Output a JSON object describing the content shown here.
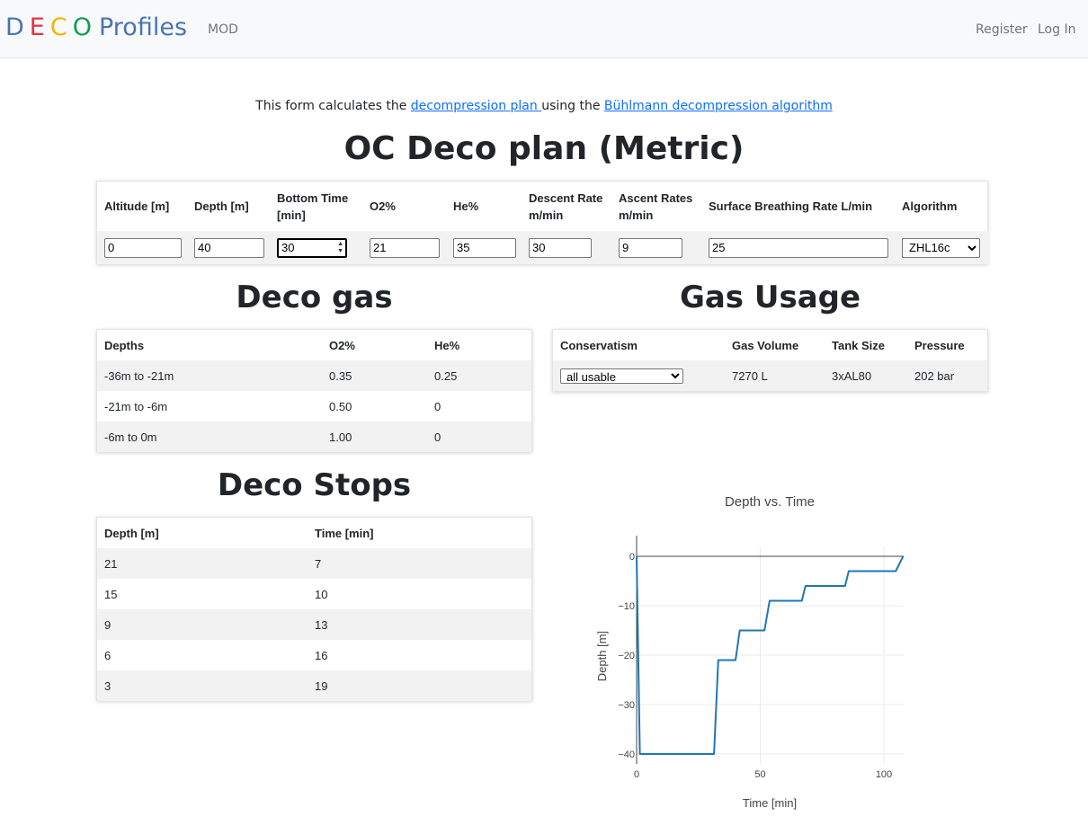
{
  "nav": {
    "brand_letters": [
      {
        "text": "D",
        "color": "#4a73b5"
      },
      {
        "text": "E",
        "color": "#e8313f"
      },
      {
        "text": "C",
        "color": "#f4b400"
      },
      {
        "text": "O",
        "color": "#0f9d58"
      }
    ],
    "brand_word": "Profiles",
    "mod_link": "MOD",
    "register": "Register",
    "login": "Log In"
  },
  "intro": {
    "prefix": "This form calculates the ",
    "link1": "decompression plan ",
    "middle": "using the ",
    "link2": "Bühlmann decompression algorithm"
  },
  "title": "OC Deco plan (Metric)",
  "plan": {
    "headers": {
      "altitude": "Altitude [m]",
      "depth": "Depth [m]",
      "bottom_time_1": "Bottom Time",
      "bottom_time_2": "[min]",
      "o2": "O2%",
      "he": "He%",
      "descent_1": "Descent Rate",
      "descent_2": "m/min",
      "ascent_1": "Ascent Rates",
      "ascent_2": "m/min",
      "sbr": "Surface Breathing Rate L/min",
      "algorithm": "Algorithm"
    },
    "values": {
      "altitude": "0",
      "depth": "40",
      "bottom_time": "30",
      "o2": "21",
      "he": "35",
      "descent": "30",
      "ascent": "9",
      "sbr": "25",
      "algorithm": "ZHL16c"
    }
  },
  "deco_gas": {
    "title": "Deco gas",
    "headers": {
      "depths": "Depths",
      "o2": "O2%",
      "he": "He%"
    },
    "rows": [
      {
        "depths": "-36m to -21m",
        "o2": "0.35",
        "he": "0.25"
      },
      {
        "depths": "-21m to -6m",
        "o2": "0.50",
        "he": "0"
      },
      {
        "depths": "-6m to 0m",
        "o2": "1.00",
        "he": "0"
      }
    ]
  },
  "gas_usage": {
    "title": "Gas Usage",
    "headers": {
      "conservatism": "Conservatism",
      "volume": "Gas Volume",
      "tank": "Tank Size",
      "pressure": "Pressure"
    },
    "row": {
      "conservatism": "all usable",
      "volume": "7270 L",
      "tank": "3xAL80",
      "pressure": "202 bar"
    }
  },
  "deco_stops": {
    "title": "Deco Stops",
    "headers": {
      "depth": "Depth [m]",
      "time": "Time [min]"
    },
    "rows": [
      {
        "depth": "21",
        "time": "7"
      },
      {
        "depth": "15",
        "time": "10"
      },
      {
        "depth": "9",
        "time": "13"
      },
      {
        "depth": "6",
        "time": "16"
      },
      {
        "depth": "3",
        "time": "19"
      }
    ]
  },
  "chart_data": {
    "type": "line",
    "title": "Depth vs. Time",
    "xlabel": "Time [min]",
    "ylabel": "Depth [m]",
    "xlim": [
      0,
      108
    ],
    "ylim": [
      -42,
      2
    ],
    "xticks": [
      "0",
      "50",
      "100"
    ],
    "xtick_values": [
      0,
      50,
      100
    ],
    "yticks": [
      "0",
      "−10",
      "−20",
      "−30",
      "−40"
    ],
    "ytick_values": [
      0,
      -10,
      -20,
      -30,
      -40
    ],
    "grid": true,
    "color": "#1f77b4",
    "series": [
      {
        "x": [
          0,
          1.3,
          31.3,
          33.0,
          40.0,
          41.7,
          51.7,
          53.8,
          66.8,
          68.3,
          84.3,
          85.8,
          104.8,
          107.8
        ],
        "y": [
          0,
          -40,
          -40,
          -21,
          -21,
          -15,
          -15,
          -9,
          -9,
          -6,
          -6,
          -3,
          -3,
          0
        ]
      }
    ]
  }
}
